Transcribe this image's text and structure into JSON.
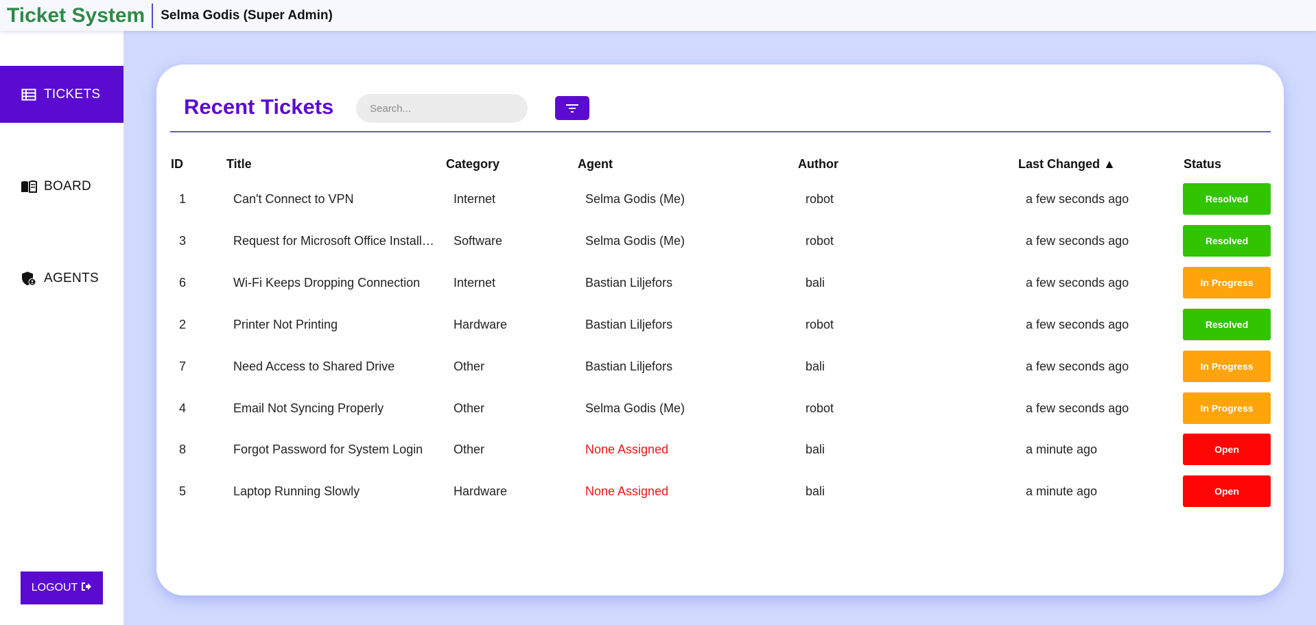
{
  "header": {
    "brand": "Ticket System",
    "user": "Selma Godis (Super Admin)"
  },
  "sidebar": {
    "items": [
      {
        "label": "TICKETS",
        "icon": "table-list-icon",
        "active": true
      },
      {
        "label": "BOARD",
        "icon": "book-open-icon",
        "active": false
      },
      {
        "label": "AGENTS",
        "icon": "shield-user-icon",
        "active": false
      }
    ],
    "logout_label": "LOGOUT",
    "logout_icon": "sign-out-icon"
  },
  "tickets": {
    "title": "Recent Tickets",
    "search_placeholder": "Search...",
    "filter_icon": "filter-lines-icon",
    "columns": {
      "id": "ID",
      "title": "Title",
      "category": "Category",
      "agent": "Agent",
      "author": "Author",
      "last_changed": "Last Changed ▲",
      "status": "Status"
    },
    "rows": [
      {
        "id": "1",
        "title": "Can't Connect to VPN",
        "category": "Internet",
        "agent": "Selma Godis (Me)",
        "author": "robot",
        "last_changed": "a few seconds ago",
        "status": "Resolved"
      },
      {
        "id": "3",
        "title": "Request for Microsoft Office Installation",
        "category": "Software",
        "agent": "Selma Godis (Me)",
        "author": "robot",
        "last_changed": "a few seconds ago",
        "status": "Resolved"
      },
      {
        "id": "6",
        "title": "Wi-Fi Keeps Dropping Connection",
        "category": "Internet",
        "agent": "Bastian Liljefors",
        "author": "bali",
        "last_changed": "a few seconds ago",
        "status": "In Progress"
      },
      {
        "id": "2",
        "title": "Printer Not Printing",
        "category": "Hardware",
        "agent": "Bastian Liljefors",
        "author": "robot",
        "last_changed": "a few seconds ago",
        "status": "Resolved"
      },
      {
        "id": "7",
        "title": "Need Access to Shared Drive",
        "category": "Other",
        "agent": "Bastian Liljefors",
        "author": "bali",
        "last_changed": "a few seconds ago",
        "status": "In Progress"
      },
      {
        "id": "4",
        "title": "Email Not Syncing Properly",
        "category": "Other",
        "agent": "Selma Godis (Me)",
        "author": "robot",
        "last_changed": "a few seconds ago",
        "status": "In Progress"
      },
      {
        "id": "8",
        "title": "Forgot Password for System Login",
        "category": "Other",
        "agent": "None Assigned",
        "author": "bali",
        "last_changed": "a minute ago",
        "status": "Open"
      },
      {
        "id": "5",
        "title": "Laptop Running Slowly",
        "category": "Hardware",
        "agent": "None Assigned",
        "author": "bali",
        "last_changed": "a minute ago",
        "status": "Open"
      }
    ]
  },
  "colors": {
    "accent": "#5b0bd1",
    "brand": "#2e8a48",
    "resolved": "#32c400",
    "in_progress": "#ffa40b",
    "open": "#ff0606",
    "unassigned_text": "#f01515"
  }
}
